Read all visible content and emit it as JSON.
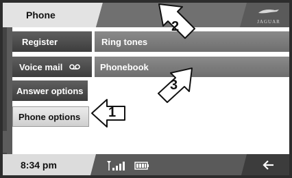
{
  "header": {
    "title": "Phone",
    "brand_logo_text": "JAGUAR"
  },
  "menu": {
    "register": "Register",
    "voice_mail": "Voice mail",
    "voice_mail_icon": "voicemail-icon",
    "answer_options": "Answer options",
    "phone_options": "Phone options",
    "ring_tones": "Ring tones",
    "phonebook": "Phonebook"
  },
  "callouts": {
    "one": "1",
    "two": "2",
    "three": "3"
  },
  "status_bar": {
    "time": "8:34 pm",
    "signal_icon": "signal-strength-icon",
    "battery_icon": "battery-icon",
    "back_icon": "back-arrow-icon"
  }
}
